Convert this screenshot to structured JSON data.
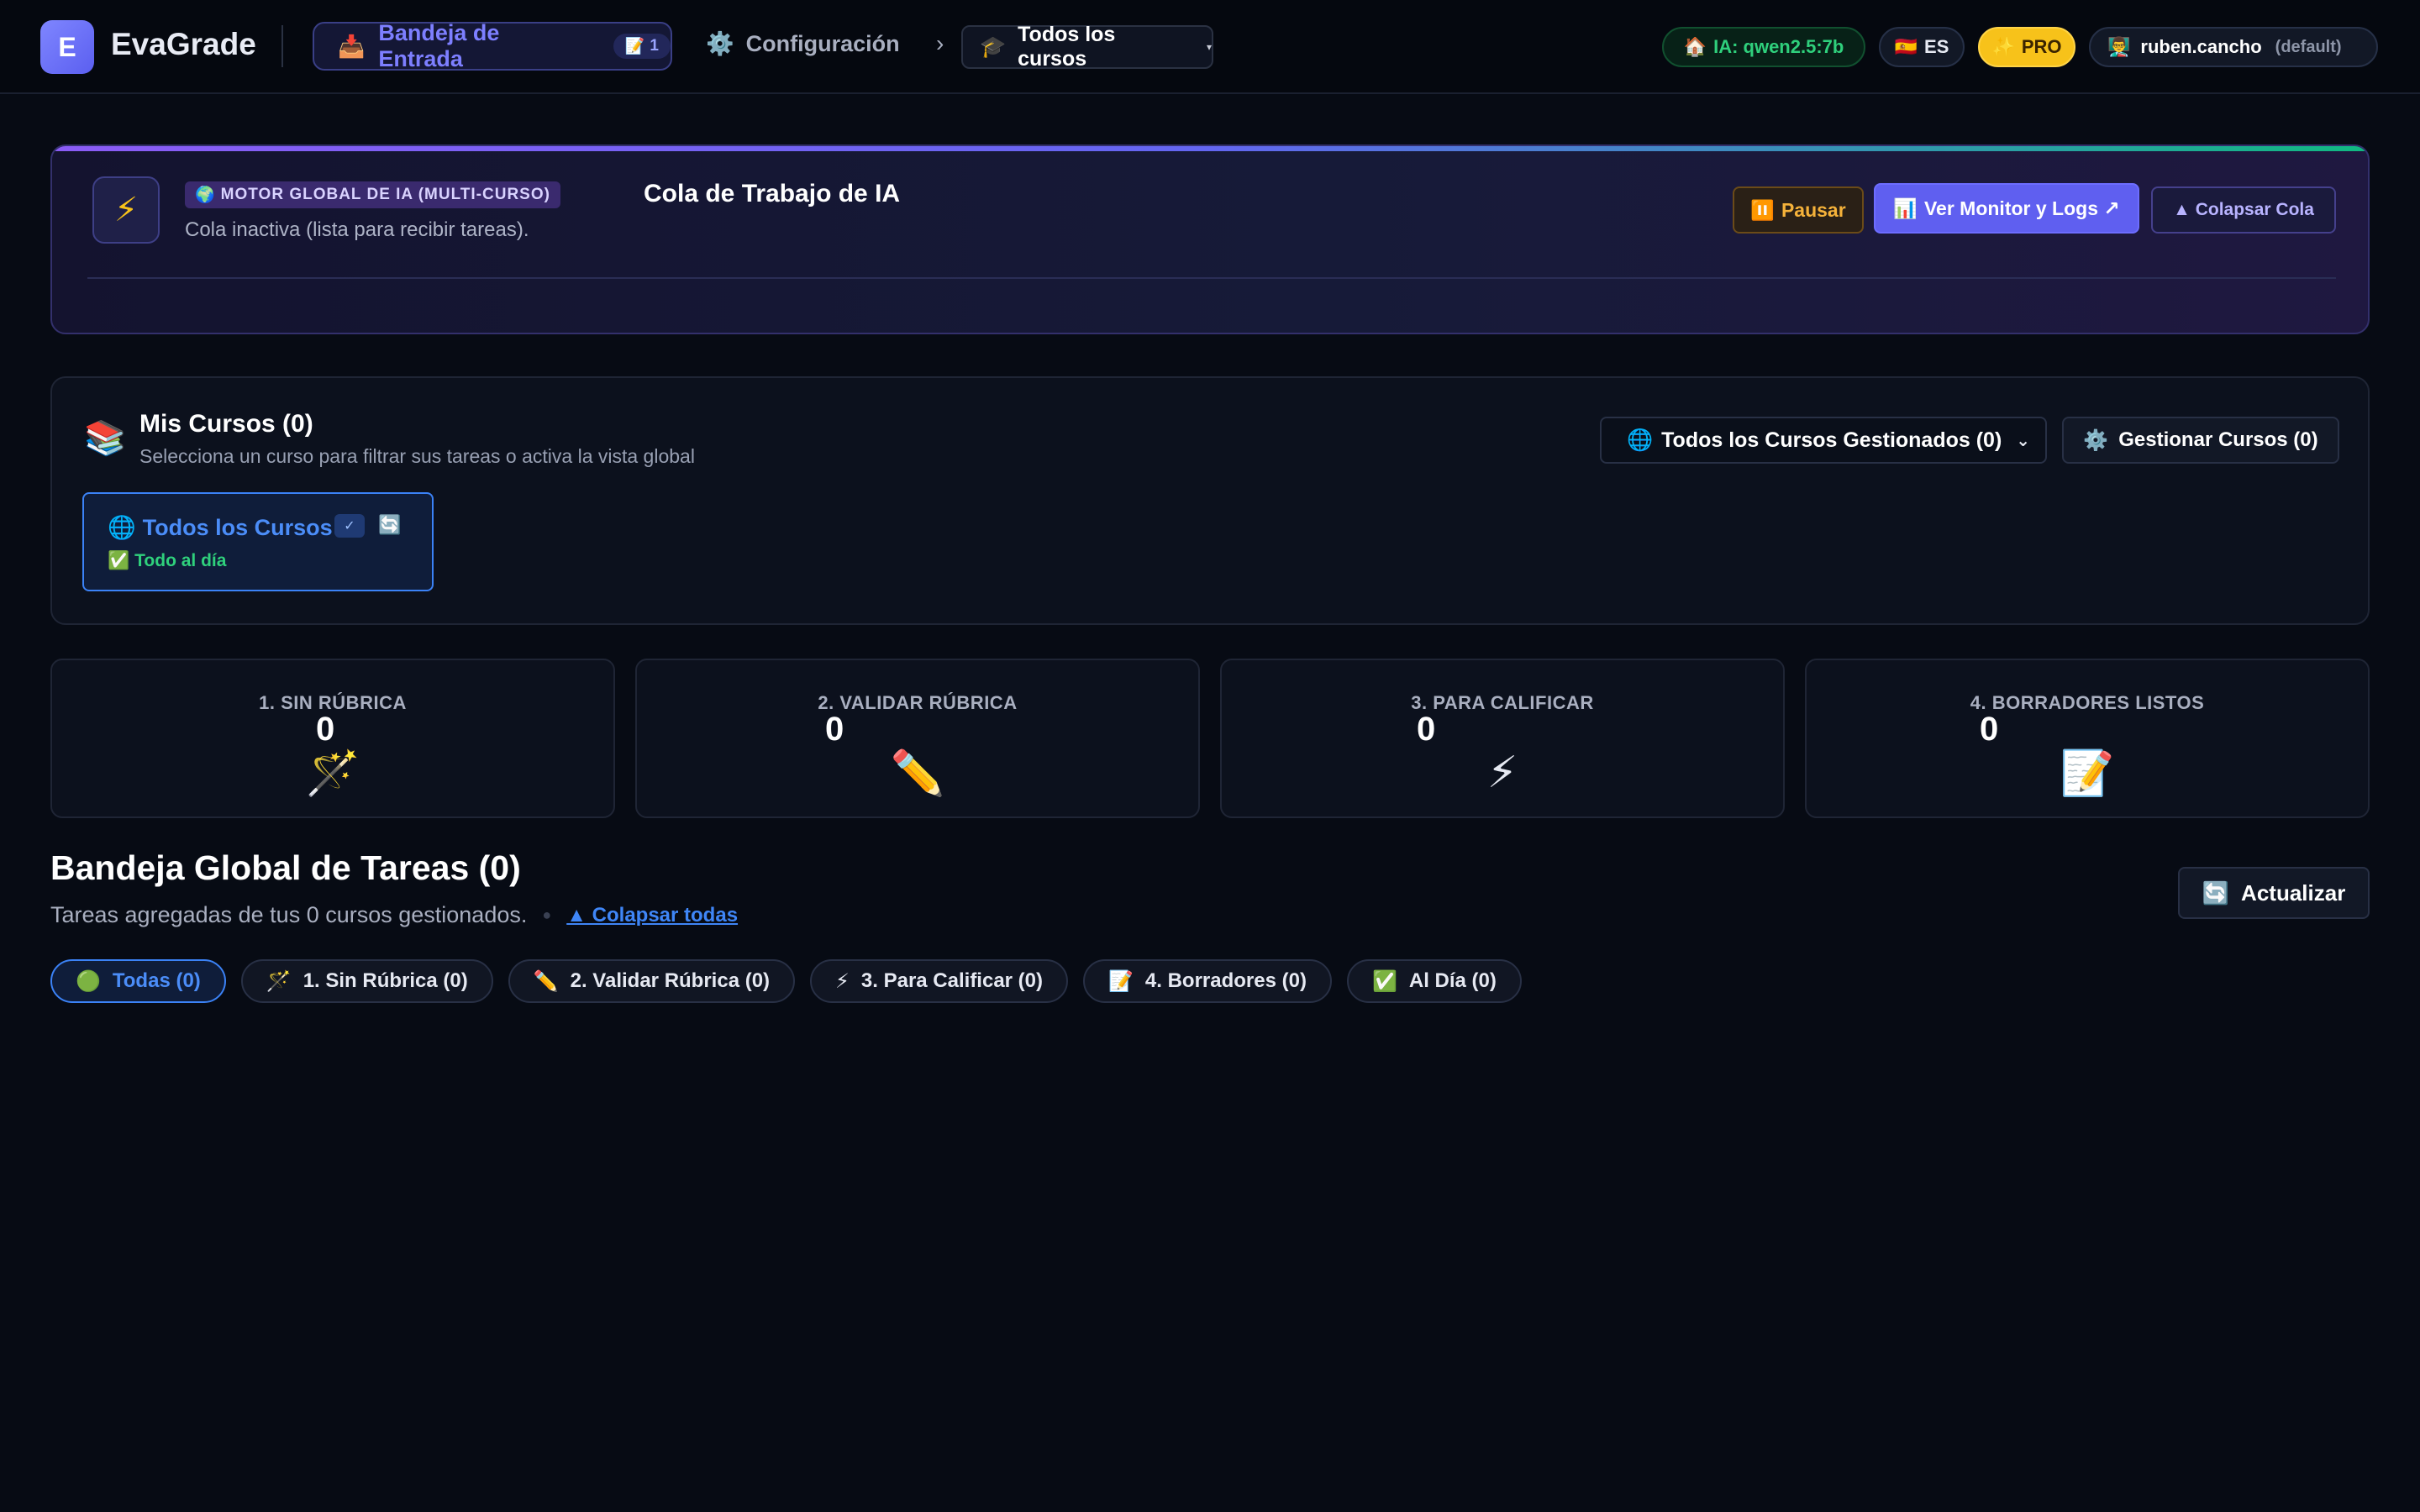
{
  "app": {
    "logo_letter": "E",
    "name": "EvaGrade"
  },
  "nav": {
    "inbox": {
      "icon": "📥",
      "label": "Bandeja de Entrada",
      "badge_icon": "📝",
      "badge_count": "1"
    },
    "config": {
      "icon": "⚙️",
      "label": "Configuración"
    },
    "breadcrumb_chevron": "›",
    "course_selector": {
      "icon": "🎓",
      "value": "Todos los cursos",
      "caret": "▾"
    }
  },
  "header_right": {
    "ai_model": {
      "icon": "🏠",
      "label": "IA: qwen2.5:7b"
    },
    "language": {
      "flag": "🇪🇸",
      "label": "ES"
    },
    "plan": {
      "icon": "✨",
      "label": "PRO"
    },
    "user": {
      "avatar": "👨‍🏫",
      "name": "ruben.cancho",
      "profile": "(default)"
    }
  },
  "queue": {
    "icon": "⚡",
    "tag_icon": "🌍",
    "tag": "MOTOR GLOBAL DE IA (MULTI-CURSO)",
    "title": "Cola de Trabajo de IA",
    "status": "Cola inactiva (lista para recibir tareas).",
    "buttons": {
      "pause": {
        "icon": "⏸️",
        "label": "Pausar"
      },
      "monitor": {
        "icon": "📊",
        "label": "Ver Monitor y Logs ↗"
      },
      "collapse": {
        "label": "▲ Colapsar Cola"
      }
    }
  },
  "courses": {
    "icon": "📚",
    "title": "Mis Cursos (0)",
    "subtitle": "Selecciona un curso para filtrar sus tareas o activa la vista global",
    "filter_select": {
      "icon": "🌐",
      "value": "Todos los Cursos Gestionados (0)",
      "caret": "⌄"
    },
    "manage_button": {
      "icon": "⚙️",
      "label": "Gestionar Cursos (0)"
    },
    "tile": {
      "icon": "🌐",
      "name": "Todos los Cursos",
      "check": "✓",
      "sync_icon": "🔄",
      "status_icon": "✅",
      "status": "Todo al día"
    }
  },
  "stats": [
    {
      "label": "1. SIN RÚBRICA",
      "value": "0",
      "icon": "🪄"
    },
    {
      "label": "2. VALIDAR RÚBRICA",
      "value": "0",
      "icon": "✏️"
    },
    {
      "label": "3. PARA CALIFICAR",
      "value": "0",
      "icon": "⚡"
    },
    {
      "label": "4. BORRADORES LISTOS",
      "value": "0",
      "icon": "📝"
    }
  ],
  "inbox": {
    "title": "Bandeja Global de Tareas (0)",
    "subtitle": "Tareas agregadas de tus 0 cursos gestionados.",
    "separator": "●",
    "collapse_all": "▲ Colapsar todas",
    "refresh": {
      "icon": "🔄",
      "label": "Actualizar"
    },
    "filters": [
      {
        "icon": "🟢",
        "label": "Todas (0)",
        "active": true
      },
      {
        "icon": "🪄",
        "label": "1. Sin Rúbrica (0)",
        "active": false
      },
      {
        "icon": "✏️",
        "label": "2. Validar Rúbrica (0)",
        "active": false
      },
      {
        "icon": "⚡",
        "label": "3. Para Calificar (0)",
        "active": false
      },
      {
        "icon": "📝",
        "label": "4. Borradores (0)",
        "active": false
      },
      {
        "icon": "✅",
        "label": "Al Día (0)",
        "active": false
      }
    ]
  },
  "colors": {
    "background": "#070b14",
    "accent": "#5f5ff0",
    "active_blue": "#3b82f6",
    "success": "#2fd07c",
    "warning": "#f5b23a",
    "pro": "#f7c21a"
  }
}
